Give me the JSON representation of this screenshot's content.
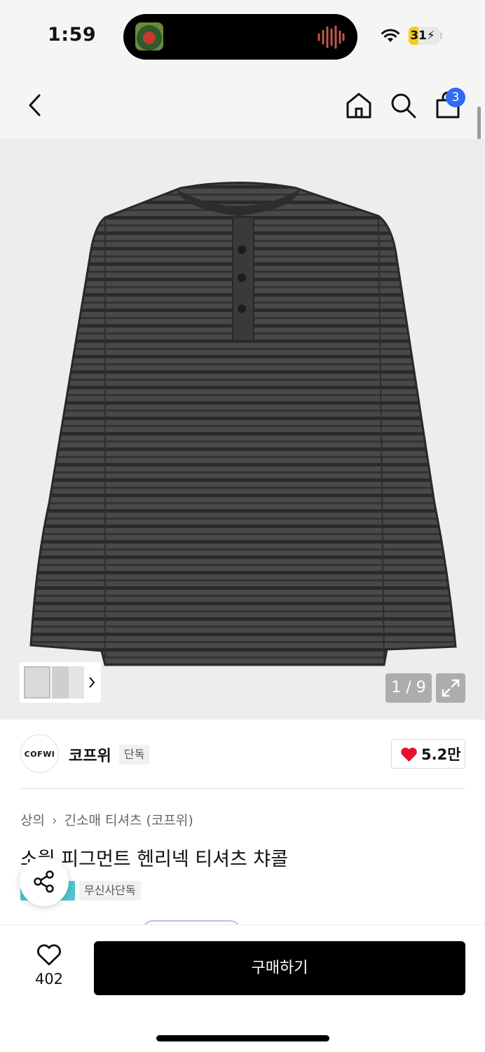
{
  "status_bar": {
    "time": "1:59",
    "battery_level": "31",
    "battery_fraction": 0.31,
    "icons": [
      "now-playing-artwork",
      "audio-waveform-icon",
      "wifi-icon",
      "battery-icon"
    ]
  },
  "nav": {
    "icons": [
      "back-icon",
      "home-icon",
      "search-icon",
      "cart-icon"
    ],
    "cart_count": "3"
  },
  "gallery": {
    "counter": "1 / 9",
    "current_index": 1,
    "total": 9,
    "product_color": "#3e3d3b"
  },
  "brand": {
    "logo_text": "COFWI",
    "name": "코프위",
    "tag": "단독",
    "like_count": "5.2만"
  },
  "product": {
    "breadcrumb": [
      "상의",
      "긴소매 티셔츠 (코프위)"
    ],
    "title": "소월 피그먼트 헨리넥 티셔츠 챠콜",
    "tag_musinsa": "무신사단독"
  },
  "bottom_bar": {
    "wish_count": "402",
    "buy_label": "구매하기"
  },
  "colors": {
    "accent_badge": "#2f6af5",
    "heart_red": "#e8112d",
    "button_black": "#000000",
    "tag_teal": "#4fc6d0"
  }
}
